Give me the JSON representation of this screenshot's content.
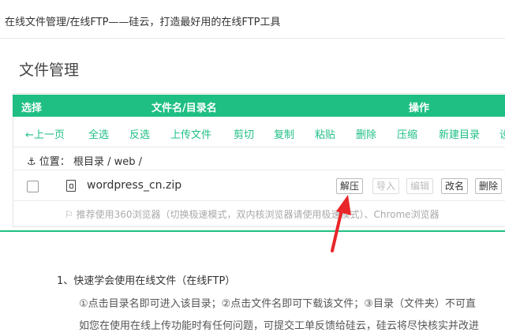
{
  "header": {
    "title": "在线文件管理/在线FTP——硅云，打造最好用的在线FTP工具"
  },
  "section": {
    "title": "文件管理"
  },
  "table": {
    "headers": {
      "select": "选择",
      "name": "文件名/目录名",
      "actions": "操作"
    }
  },
  "toolbar": {
    "items": [
      "←上一页",
      "全选",
      "反选",
      "上传文件",
      "剪切",
      "复制",
      "粘贴",
      "删除",
      "压缩",
      "新建目录",
      "设"
    ]
  },
  "location": {
    "anchor": "⚓",
    "label": "位置：",
    "path": "根目录 / web /"
  },
  "file": {
    "name": "wordpress_cn.zip",
    "actions": [
      "解压",
      "导入",
      "编辑",
      "改名",
      "删除"
    ]
  },
  "notice": {
    "icon": "⚐",
    "text": "推荐使用360浏览器（切换极速模式，双内核浏览器请使用极速模式）、Chrome浏览器"
  },
  "help": {
    "heading": "1、快速学会使用在线文件（在线FTP）",
    "line1": "①点击目录名即可进入该目录；②点击文件名即可下载该文件；③目录（文件夹）不可直",
    "line2": "如您在使用在线上传功能时有任何问题，可提交工单反馈给硅云，硅云将尽快核实并改进"
  },
  "colors": {
    "accent": "#1fbf84",
    "arrow": "#e8262a"
  }
}
